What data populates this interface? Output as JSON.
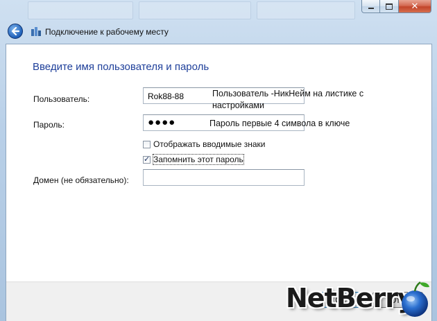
{
  "window": {
    "title": "Подключение к рабочему месту",
    "close_glyph": "✕"
  },
  "dialog": {
    "heading": "Введите имя пользователя и пароль",
    "fields": {
      "user_label": "Пользователь:",
      "user_value": "Rok88-88",
      "password_label": "Пароль:",
      "password_mask": "●●●●",
      "domain_label": "Домен (не обязательно):",
      "domain_value": ""
    },
    "checkboxes": {
      "show_chars": {
        "label": "Отображать вводимые знаки",
        "checked": false
      },
      "remember": {
        "label": "Запомнить этот пароль",
        "checked": true,
        "mark": "✓"
      }
    },
    "annotations": {
      "user_note_line1": "Пользователь -НикНейм на листике с",
      "user_note_line2": "настройками",
      "password_note": "Пароль первые 4 символа в ключе"
    },
    "buttons": {
      "ok_label": "ОК",
      "cancel_label": "Отм"
    }
  },
  "watermark": {
    "text": "NetBerry"
  },
  "colors": {
    "heading": "#1e3f9a",
    "back_button": "#1e5fb8",
    "close_button": "#c3452a",
    "berry": "#2b6fd0"
  },
  "icons": [
    "back-arrow-icon",
    "network-connection-icon",
    "minimize-icon",
    "maximize-icon",
    "close-icon",
    "checkbox-check-icon",
    "berry-logo-icon"
  ]
}
